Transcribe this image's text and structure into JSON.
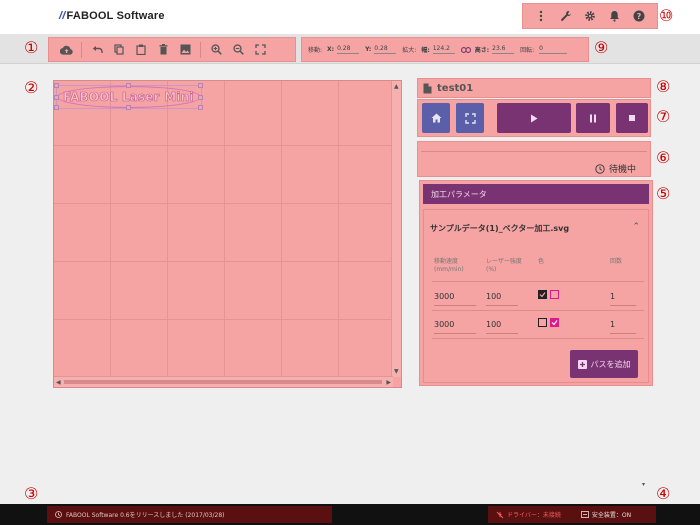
{
  "app": {
    "logo_text": "FABOOL Software"
  },
  "header_icons": [
    "more-vert-icon",
    "wrench-icon",
    "gear-icon",
    "bell-icon",
    "help-icon"
  ],
  "toolbar": {
    "buttons": [
      "cloud-upload-icon",
      "undo-icon",
      "copy-icon",
      "paste-icon",
      "delete-icon",
      "image-icon",
      "zoom-in-icon",
      "zoom-out-icon",
      "fit-screen-icon"
    ]
  },
  "props": {
    "move_label": "移動:",
    "x_label": "X:",
    "x_value": "0.28",
    "y_label": "Y:",
    "y_value": "0.28",
    "scale_label": "拡大:",
    "width_label": "幅:",
    "width_value": "124.2",
    "height_label": "高さ:",
    "height_value": "23.6",
    "rotate_label": "回転:",
    "rotate_value": "0"
  },
  "badges": {
    "b1": "①",
    "b2": "②",
    "b3": "③",
    "b4": "④",
    "b5": "⑤",
    "b6": "⑥",
    "b7": "⑦",
    "b8": "⑧",
    "b9": "⑨",
    "b10": "⑩"
  },
  "canvas": {
    "design_text": "FABOOL Laser Mini"
  },
  "file": {
    "name": "test01"
  },
  "controls": [
    "home-icon",
    "frame-icon",
    "play-icon",
    "pause-icon",
    "stop-icon"
  ],
  "status": {
    "text": "待機中"
  },
  "params": {
    "header": "加工パラメータ",
    "file_title": "サンプルデータ(1)_ベクター加工.svg",
    "col_speed": "移動速度",
    "col_speed_unit": "(mm/min)",
    "col_power": "レーザー強度",
    "col_power_unit": "(%)",
    "col_color": "色",
    "col_passes": "回数",
    "rows": [
      {
        "speed": "3000",
        "power": "100",
        "black_checked": true,
        "magenta_checked": false,
        "passes": "1"
      },
      {
        "speed": "3000",
        "power": "100",
        "black_checked": false,
        "magenta_checked": true,
        "passes": "1"
      }
    ],
    "add_path": "パスを追加"
  },
  "bottom": {
    "news": "FABOOL Software 0.6をリリースしました (2017/03/28)",
    "driver": "ドライバー：未接続",
    "safety": "安全装置：ON"
  },
  "colors": {
    "accent_purple": "#7a3372",
    "button_blue": "#5b5ea8",
    "highlight": "#f5a3a3",
    "badge_red": "#cc0000"
  }
}
